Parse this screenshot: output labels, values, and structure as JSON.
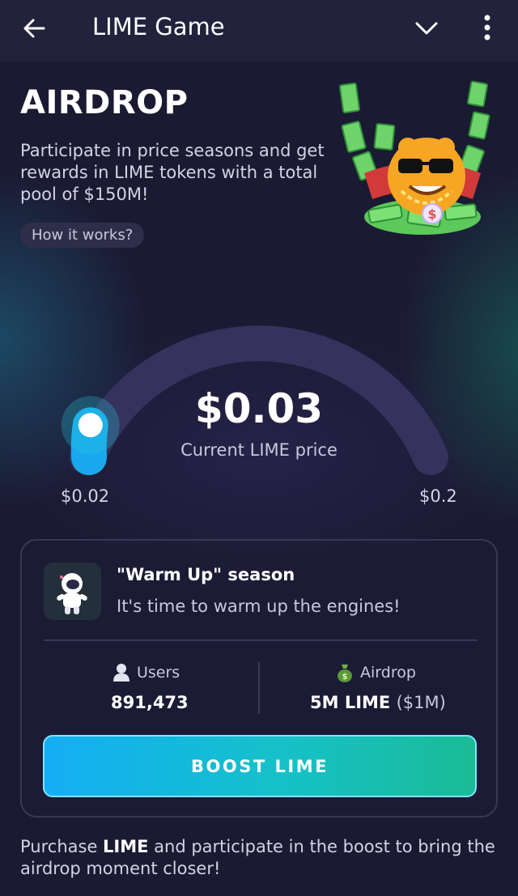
{
  "header": {
    "title": "LIME Game",
    "back_icon": "arrow-left-icon",
    "menu_icon": "chevron-down-icon",
    "more_icon": "more-vertical-icon"
  },
  "airdrop": {
    "title": "AIRDROP",
    "description": "Participate in price seasons and get rewards in LIME tokens with a total pool of $150M!",
    "how_it_works": "How it works?",
    "mascot_icon": "mascot-money-icon"
  },
  "gauge": {
    "current_price": "$0.03",
    "current_label": "Current LIME price",
    "min_label": "$0.02",
    "max_label": "$0.2",
    "progress": 0.06,
    "colors": {
      "track": "#35325e",
      "fill": "#19a8ee",
      "knob": "#ffffff"
    }
  },
  "season": {
    "icon": "astronaut-icon",
    "title": "\"Warm Up\" season",
    "subtitle": "It's time to warm up the engines!",
    "users_label": "Users",
    "users_icon": "user-icon",
    "users_value": "891,473",
    "airdrop_label": "Airdrop",
    "airdrop_icon": "money-bag-icon",
    "airdrop_value": "5M LIME",
    "airdrop_value_usd": "($1M)",
    "boost_button": "BOOST LIME"
  },
  "footer": {
    "prefix": "Purchase ",
    "bold": "LIME",
    "suffix": " and participate in the boost to bring the airdrop moment closer!"
  }
}
